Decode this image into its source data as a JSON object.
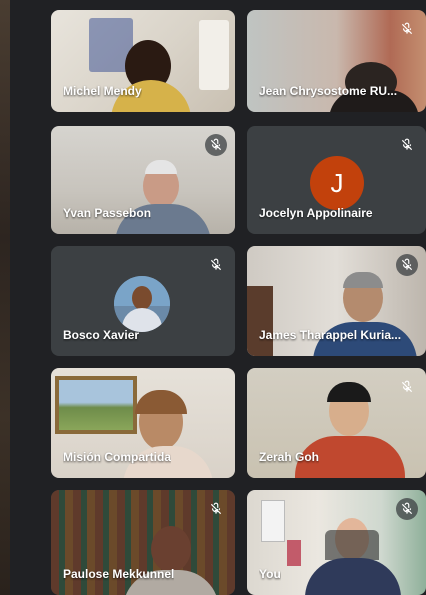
{
  "participants": [
    {
      "name": "Michel Mendy",
      "muted": false
    },
    {
      "name": "Jean Chrysostome RU...",
      "muted": true
    },
    {
      "name": "Yvan Passebon",
      "muted": true
    },
    {
      "name": "Jocelyn Appolinaire",
      "muted": true,
      "avatar_letter": "J",
      "avatar_color": "#c2410c"
    },
    {
      "name": "Bosco Xavier",
      "muted": true
    },
    {
      "name": "James Tharappel Kuria...",
      "muted": true
    },
    {
      "name": "Misión Compartida",
      "muted": false
    },
    {
      "name": "Zerah Goh",
      "muted": true
    },
    {
      "name": "Paulose Mekkunnel",
      "muted": true
    },
    {
      "name": "You",
      "muted": true
    }
  ],
  "colors": {
    "background": "#202124",
    "tile": "#3c4043",
    "mic_off_icon": "#ffffff"
  }
}
